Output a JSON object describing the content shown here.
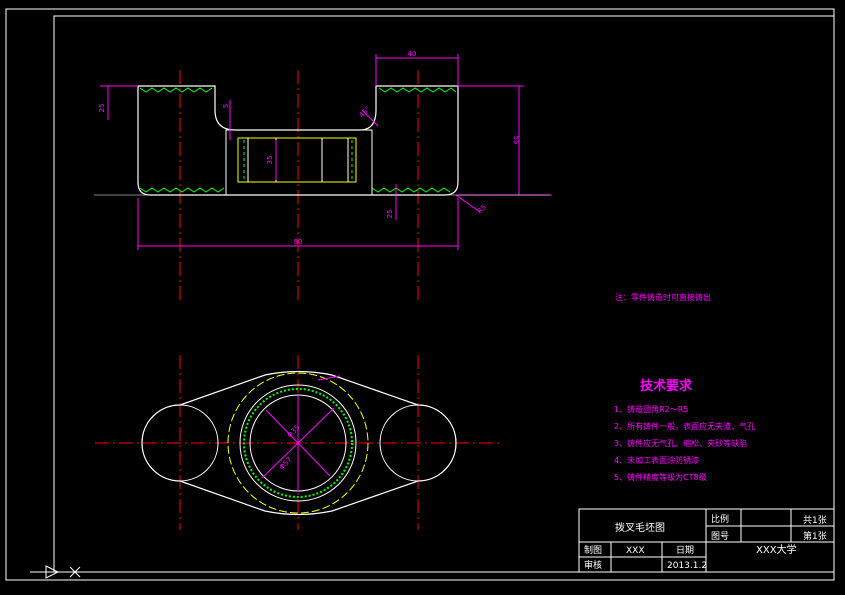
{
  "drawing": {
    "note": "注：零件铸造时可直接铸出",
    "tech_req": {
      "title": "技术要求",
      "items": [
        "1、铸造圆角R2～R5",
        "2、所有铸件一般，表面应无夹渣、气孔",
        "3、铸件应无气孔、缩松、夹砂等缺陷",
        "4、未加工表面涂防锈漆",
        "5、铸件精度等级为CT8级"
      ]
    },
    "dims": {
      "top_width": "40",
      "overall_width": "90",
      "height": "55",
      "left_thickness": "25",
      "step": "5",
      "bore": "35",
      "bottom_thickness": "25",
      "slope_angle": "45°",
      "corner_radius": "R5",
      "dia_1": "Φ35",
      "dia_2": "Φ57"
    }
  },
  "title_block": {
    "drawing_name": "拨叉毛坯图",
    "scale_label": "比例",
    "drawing_no_label": "图号",
    "count_label": "共1张",
    "sheet_label": "第1张",
    "drawer_label": "制图",
    "drawer_name": "XXX",
    "date_label": "日期",
    "date": "2013.1.2",
    "reviewer_label": "审核",
    "school": "XXX大学"
  },
  "colors": {
    "frame": "#ffffff",
    "outline": "#ffffff",
    "center_line": "#ff0000",
    "dimension": "#ff00ff",
    "hatch": "#00ff00",
    "hidden": "#ffff00"
  }
}
